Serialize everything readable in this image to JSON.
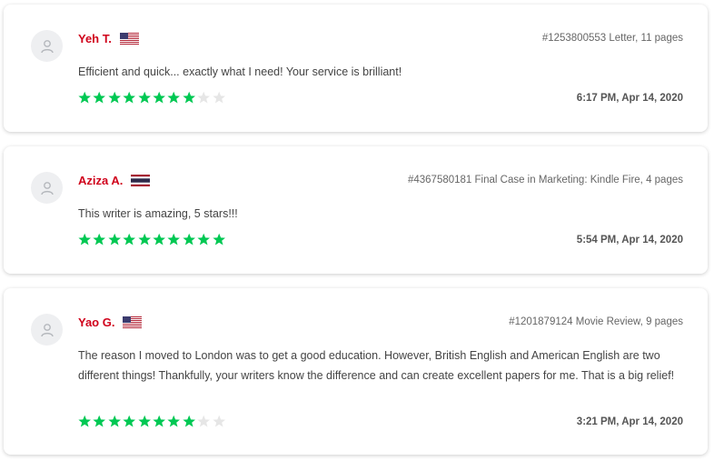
{
  "reviews": [
    {
      "name": "Yeh T.",
      "flag": "us-flag",
      "order": "#1253800553 Letter, 11 pages",
      "text": "Efficient and quick... exactly what I need! Your service is brilliant!",
      "rating": 8,
      "max_rating": 10,
      "date": "6:17 PM, Apr 14, 2020"
    },
    {
      "name": "Aziza A.",
      "flag": "thailand-flag",
      "order": "#4367580181 Final Case in Marketing: Kindle Fire, 4 pages",
      "text": "This writer is amazing, 5 stars!!!",
      "rating": 10,
      "max_rating": 10,
      "date": "5:54 PM, Apr 14, 2020"
    },
    {
      "name": "Yao G.",
      "flag": "us-flag",
      "order": "#1201879124 Movie Review, 9 pages",
      "text": "The reason I moved to London was to get a good education. However, British English and American English are two different things! Thankfully, your writers know the difference and can create excellent papers for me. That is a big relief!",
      "rating": 8,
      "max_rating": 10,
      "date": "3:21 PM, Apr 14, 2020"
    }
  ],
  "colors": {
    "name": "#d0021b",
    "star_filled": "#00c853",
    "star_empty": "#e6e6e6"
  }
}
